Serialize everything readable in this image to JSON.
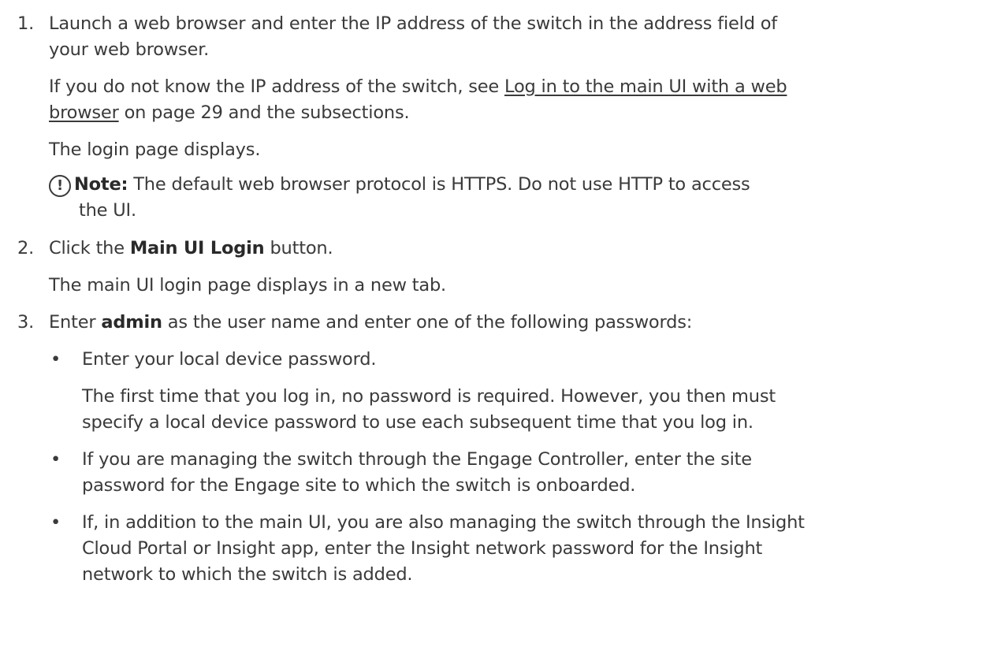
{
  "steps": [
    {
      "number": "1.",
      "line1": "Launch a web browser and enter the IP address of the switch in the address field of",
      "line2": "your web browser.",
      "xref_intro": "If you do not know the IP address of the switch, see",
      "xref_link_part1": "Log in to the main UI with a web",
      "xref_link_part2": "browser",
      "xref_tail": "on page 29 and the subsections.",
      "result": "The login page displays.",
      "note": {
        "icon": "!",
        "label": "Note:",
        "text_line1": "The default web browser protocol is HTTPS. Do not use HTTP to access",
        "text_line2": "the UI."
      }
    },
    {
      "number": "2.",
      "pre": "Click the",
      "bold": "Main UI Login",
      "post": "button.",
      "result": "The main UI login page displays in a new tab."
    },
    {
      "number": "3.",
      "pre": "Enter",
      "bold": "admin",
      "post": "as the user name and enter one of the following passwords:",
      "bullets": [
        {
          "symbol": "•",
          "line1": "Enter your local device password."
        },
        {
          "symbol": "•",
          "line1": "If you are managing the switch through the Engage Controller, enter the site",
          "line2": "password for the Engage site to which the switch is onboarded."
        },
        {
          "symbol": "•",
          "line1": "If, in addition to the main UI, you are also managing the switch through the Insight",
          "line2": "Cloud Portal or Insight app, enter the Insight network password for the Insight",
          "line3": "network to which the switch is added."
        }
      ],
      "bullet1_detail_line1": "The first time that you log in, no password is required. However, you then must",
      "bullet1_detail_line2": "specify a local device password to use each subsequent time that you log in."
    }
  ]
}
